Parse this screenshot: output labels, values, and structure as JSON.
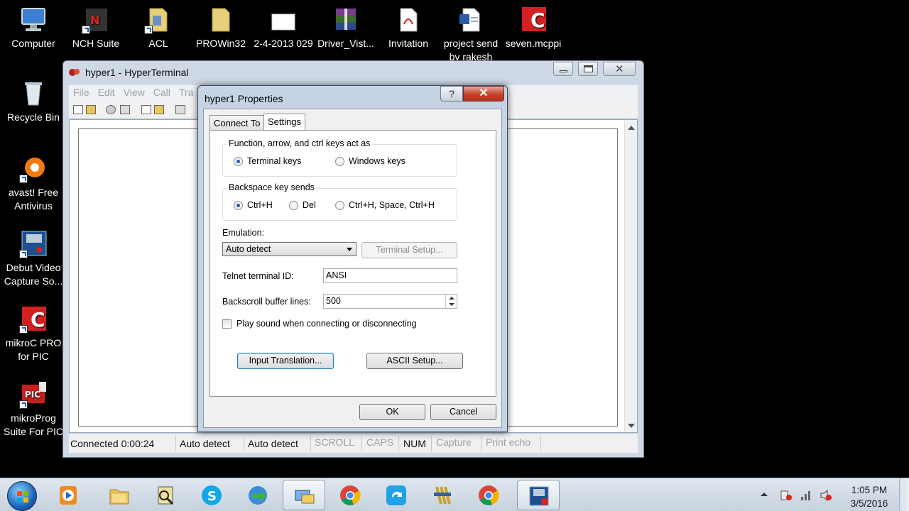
{
  "desktop": {
    "icons": [
      {
        "label": "Computer",
        "icon": "computer-icon"
      },
      {
        "label": "NCH Suite",
        "icon": "nch-suite-icon"
      },
      {
        "label": "ACL",
        "icon": "folder-icon"
      },
      {
        "label": "PROWin32",
        "icon": "folder-icon"
      },
      {
        "label": "2-4-2013 029",
        "icon": "image-file-icon"
      },
      {
        "label": "Driver_Vist...",
        "icon": "winrar-archive-icon"
      },
      {
        "label": "Invitation",
        "icon": "pdf-file-icon"
      },
      {
        "label": "project send by rakesh",
        "icon": "word-document-icon"
      },
      {
        "label": "seven.mcppi",
        "icon": "mikroc-file-icon"
      },
      {
        "label": "Recycle Bin",
        "icon": "recycle-bin-icon"
      },
      {
        "label": "avast! Free Antivirus",
        "icon": "avast-icon"
      },
      {
        "label": "Debut Video Capture So...",
        "icon": "debut-video-icon"
      },
      {
        "label": "mikroC PRO for PIC",
        "icon": "mikroc-icon"
      },
      {
        "label": "mikroProg Suite For PIC",
        "icon": "mikroprog-icon"
      }
    ]
  },
  "hyperterminal": {
    "title": "hyper1 - HyperTerminal",
    "menu": [
      "File",
      "Edit",
      "View",
      "Call",
      "Tra"
    ],
    "status": {
      "connected": "Connected 0:00:24",
      "detect1": "Auto detect",
      "detect2": "Auto detect",
      "scroll": "SCROLL",
      "caps": "CAPS",
      "num": "NUM",
      "capture": "Capture",
      "print_echo": "Print echo"
    }
  },
  "dialog": {
    "title": "hyper1 Properties",
    "help_label": "?",
    "close_label": "✕",
    "tabs": [
      "Connect To",
      "Settings"
    ],
    "active_tab": "Settings",
    "function_keys": {
      "label": "Function, arrow, and ctrl keys act as",
      "options": [
        "Terminal keys",
        "Windows keys"
      ],
      "selected": "Terminal keys"
    },
    "backspace": {
      "label": "Backspace key sends",
      "options": [
        "Ctrl+H",
        "Del",
        "Ctrl+H, Space, Ctrl+H"
      ],
      "selected": "Ctrl+H"
    },
    "emulation": {
      "label": "Emulation:",
      "value": "Auto detect",
      "setup_button": "Terminal Setup..."
    },
    "telnet": {
      "label": "Telnet terminal ID:",
      "value": "ANSI"
    },
    "backscroll": {
      "label": "Backscroll buffer lines:",
      "value": "500"
    },
    "play_sound": {
      "label": "Play sound when connecting or disconnecting",
      "checked": false
    },
    "input_translation_button": "Input Translation...",
    "ascii_setup_button": "ASCII Setup...",
    "ok_button": "OK",
    "cancel_button": "Cancel"
  },
  "taskbar": {
    "pinned": [
      "media-player-icon",
      "windows-explorer-icon",
      "pdf-reader-icon",
      "skype-icon",
      "internet-download-manager-icon",
      "hyperterminal-icon",
      "chrome-icon",
      "sync-app-icon",
      "winrar-icon",
      "chrome-icon",
      "video-capture-icon"
    ],
    "clock": {
      "time": "1:05 PM",
      "date": "3/5/2016"
    }
  },
  "colors": {
    "accent": "#1d5fbf",
    "close_red": "#c2412b",
    "desktop_bg": "#000000"
  }
}
